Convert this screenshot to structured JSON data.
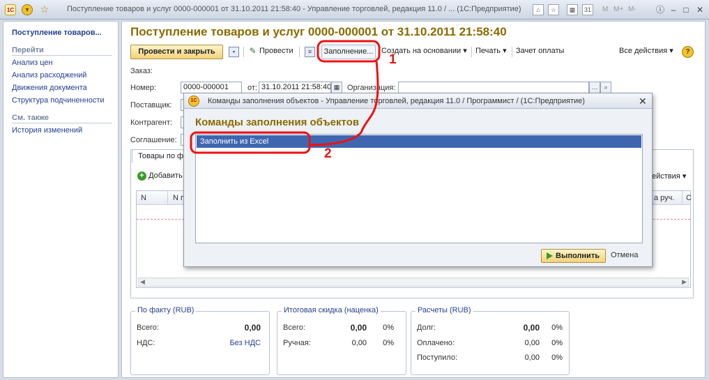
{
  "window": {
    "title": "Поступление товаров и услуг 0000-000001 от 31.10.2011 21:58:40 - Управление торговлей, редакция 11.0 / ... (1С:Предприятие)",
    "logo_text": "1С",
    "toolbar_m_labels": [
      "M",
      "M+",
      "M-"
    ]
  },
  "sidebar": {
    "title": "Поступление товаров...",
    "section_goto": "Перейти",
    "goto_items": [
      "Анализ цен",
      "Анализ расходжений",
      "Движения документа",
      "Структура подчиненности"
    ],
    "section_see_also": "См. также",
    "see_also_items": [
      "История изменений"
    ]
  },
  "document": {
    "title": "Поступление товаров и услуг 0000-000001 от 31.10.2011 21:58:40",
    "toolbar": {
      "post_close": "Провести и закрыть",
      "post": "Провести",
      "fill": "Заполнение...",
      "create_based": "Создать на основании",
      "print": "Печать",
      "payment_offset": "Зачет оплаты",
      "all_actions": "Все действия",
      "help": "?"
    },
    "fields": {
      "order_label": "Заказ:",
      "number_label": "Номер:",
      "number_value": "0000-000001",
      "date_label": "от:",
      "date_value": "31.10.2011 21:58:40",
      "org_label": "Организация:",
      "org_value": "",
      "supplier_label": "Поставщик:",
      "contractor_label": "Контрагент:",
      "agreement_label": "Соглашение:"
    },
    "tab": {
      "label": "Товары по ф",
      "add_label": "Добавить",
      "actions_label": "ействия",
      "columns": [
        "N",
        "N п",
        "а руч.",
        "С"
      ]
    },
    "totals_fact": {
      "title": "По факту (RUB)",
      "total_label": "Всего:",
      "total_value": "0,00",
      "vat_label": "НДС:",
      "vat_value": "Без НДС"
    },
    "totals_discount": {
      "title": "Итоговая скидка (наценка)",
      "total_label": "Всего:",
      "total_value": "0,00",
      "total_pct": "0%",
      "manual_label": "Ручная:",
      "manual_value": "0,00",
      "manual_pct": "0%"
    },
    "settlements": {
      "title": "Расчеты (RUB)",
      "debt_label": "Долг:",
      "debt_value": "0,00",
      "debt_pct": "0%",
      "paid_label": "Оплачено:",
      "paid_value": "0,00",
      "paid_pct": "0%",
      "received_label": "Поступило:",
      "received_value": "0,00",
      "received_pct": "0%"
    }
  },
  "dialog": {
    "title": "Команды заполнения объектов - Управление торговлей, редакция 11.0 / Программист /  (1С:Предприятие)",
    "heading": "Команды заполнения объектов",
    "items": [
      "Заполнить из Excel"
    ],
    "execute": "Выполнить",
    "cancel": "Отмена"
  },
  "annotations": {
    "marker_1": "1",
    "marker_2": "2",
    "color": "#e11111"
  }
}
